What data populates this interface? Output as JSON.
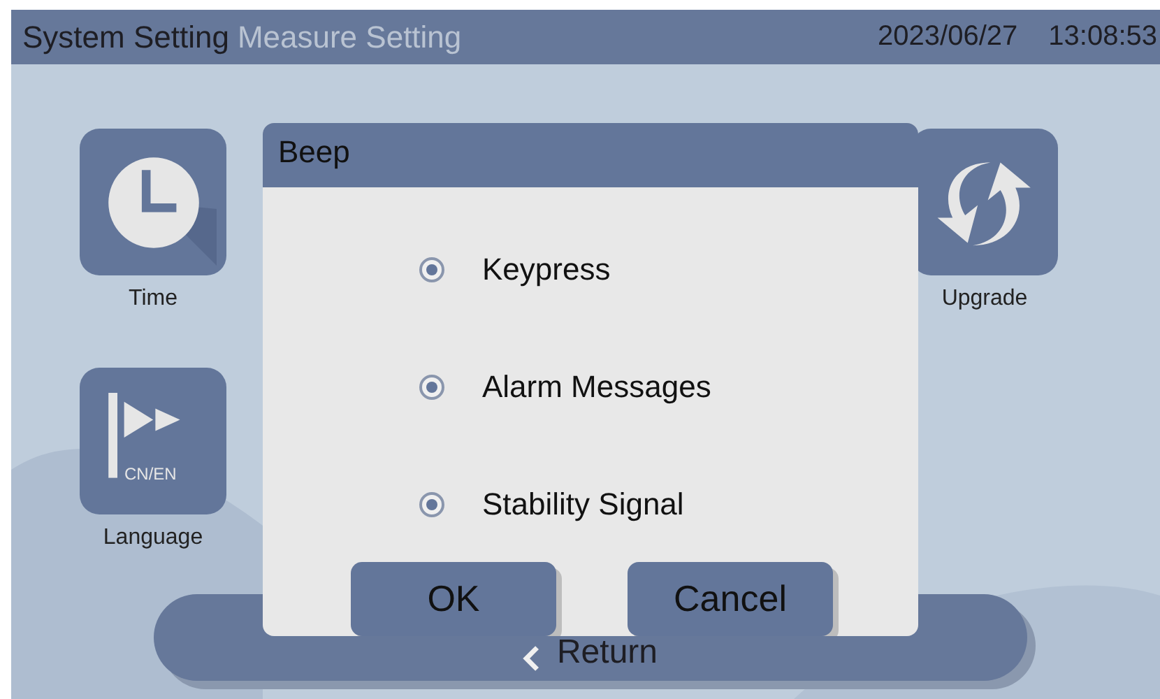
{
  "header": {
    "tabs": [
      {
        "label": "System Setting",
        "selected": true
      },
      {
        "label": "Measure Setting",
        "selected": false
      }
    ],
    "date": "2023/06/27",
    "time": "13:08:53"
  },
  "tiles": [
    {
      "label": "Time",
      "kind": "clock"
    },
    {
      "label": "Language",
      "kind": "flag",
      "badge": "CN/EN"
    },
    {
      "label": "Upgrade",
      "kind": "sync"
    }
  ],
  "return_button": {
    "label": "Return"
  },
  "dialog": {
    "title": "Beep",
    "options": [
      {
        "label": "Keypress",
        "selected": true
      },
      {
        "label": "Alarm Messages",
        "selected": true
      },
      {
        "label": "Stability Signal",
        "selected": true
      }
    ],
    "buttons": [
      "OK",
      "Cancel"
    ]
  }
}
